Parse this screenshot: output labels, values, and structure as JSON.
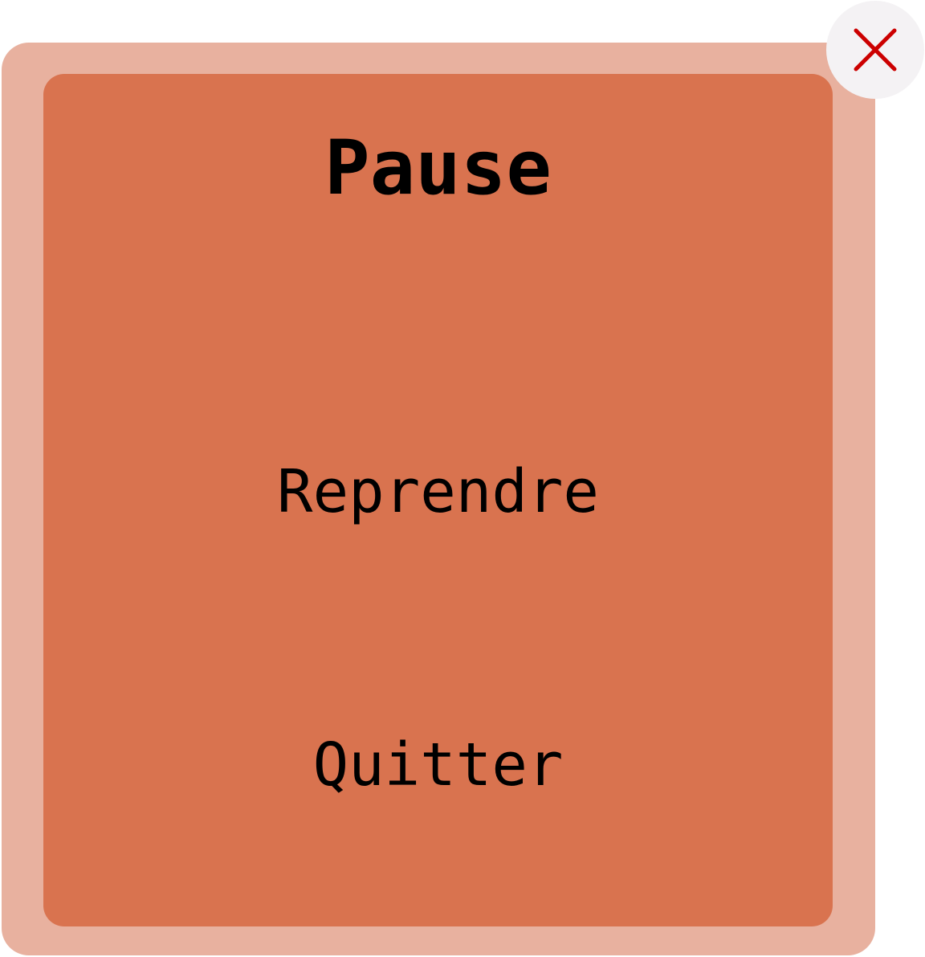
{
  "pause_menu": {
    "title": "Pause",
    "options": [
      {
        "label": "Reprendre"
      },
      {
        "label": "Quitter"
      }
    ],
    "close_icon": "close-icon"
  },
  "colors": {
    "dialog_border": "#e8b19f",
    "dialog_fill": "#d9734f",
    "close_button_bg": "#f4f2f4",
    "close_icon": "#cc0000"
  }
}
